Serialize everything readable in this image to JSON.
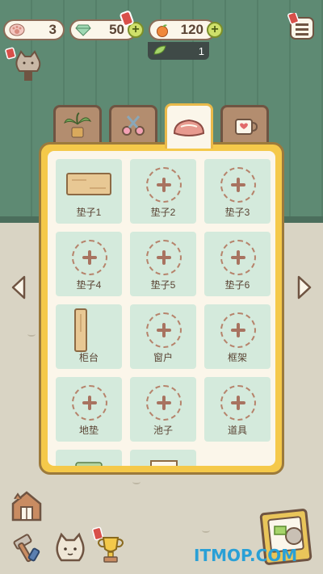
{
  "currency": {
    "paws": "3",
    "gems": "50",
    "fruit": "120",
    "leaves": "1"
  },
  "tabs": [
    {
      "name": "plants",
      "icon": "potted-plant-icon"
    },
    {
      "name": "crafts",
      "icon": "scissors-icon"
    },
    {
      "name": "cushions",
      "icon": "cushion-icon",
      "active": true
    },
    {
      "name": "dishes",
      "icon": "cup-icon"
    }
  ],
  "slots": [
    {
      "label": "垫子1",
      "filled": true,
      "item": "wooden-board"
    },
    {
      "label": "垫子2",
      "filled": false
    },
    {
      "label": "垫子3",
      "filled": false
    },
    {
      "label": "垫子4",
      "filled": false
    },
    {
      "label": "垫子5",
      "filled": false
    },
    {
      "label": "垫子6",
      "filled": false
    },
    {
      "label": "柜台",
      "filled": true,
      "item": "counter"
    },
    {
      "label": "窗户",
      "filled": false
    },
    {
      "label": "框架",
      "filled": false
    },
    {
      "label": "地垫",
      "filled": false
    },
    {
      "label": "池子",
      "filled": false
    },
    {
      "label": "道具",
      "filled": false
    }
  ],
  "watermark": "ITMOP.COM",
  "colors": {
    "wall": "#5e8a73",
    "floor": "#d9d4c4",
    "panel_border": "#f5c94a",
    "slot_bg": "#d4eadc",
    "plus_accent": "#cfe06a"
  }
}
